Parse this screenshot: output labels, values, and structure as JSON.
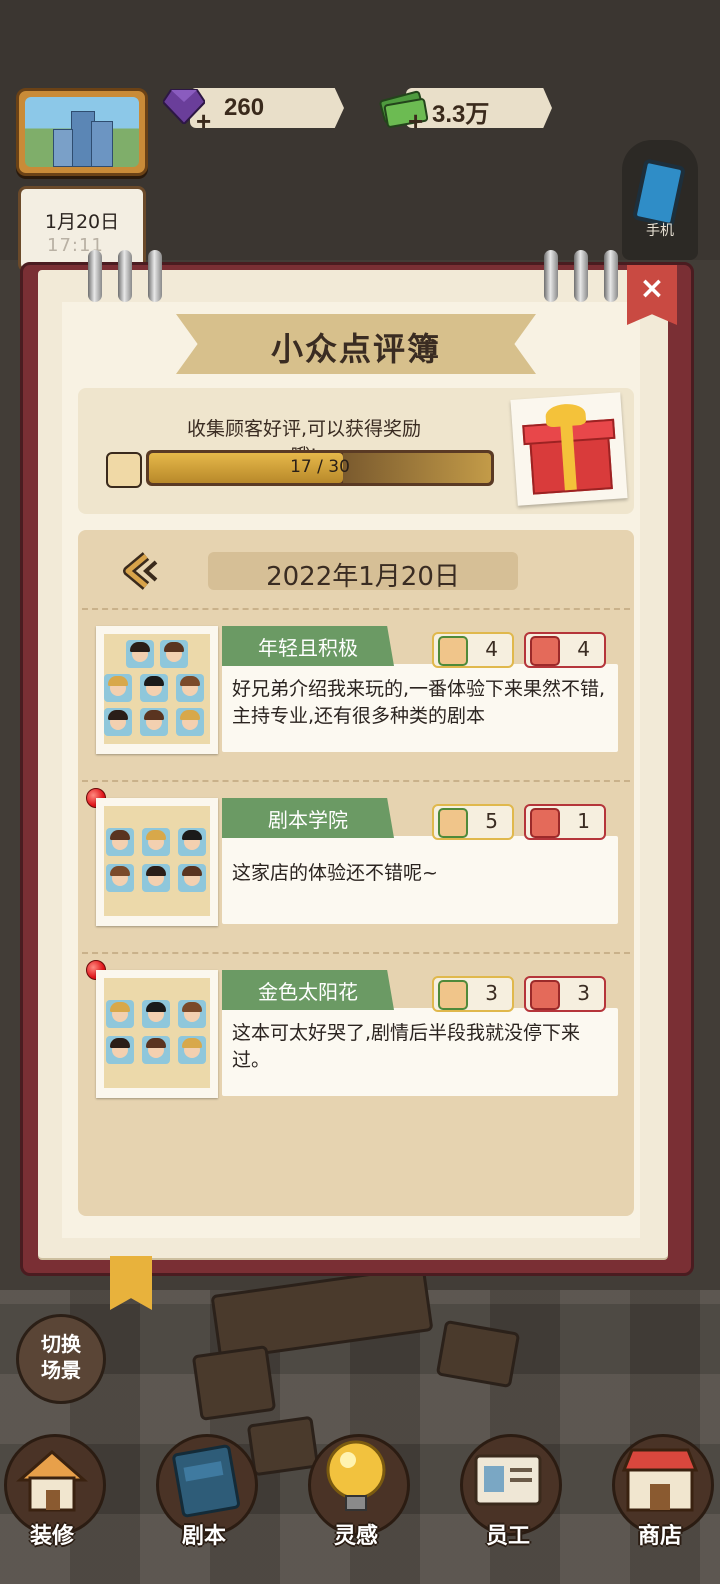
{
  "hud": {
    "gems": "260",
    "cash": "3.3万",
    "calendar_date": "1月20日",
    "calendar_time": "17:11",
    "phone_label": "手机"
  },
  "book": {
    "title": "小众点评簿",
    "close_label": "×",
    "progress_hint": "收集顾客好评,可以获得奖励哦!",
    "progress_text": "17 / 30",
    "progress_fraction": 0.567,
    "date": "2022年1月20日",
    "reviews": [
      {
        "name": "年轻且积极",
        "likes": "4",
        "dislikes": "4",
        "comment": "好兄弟介绍我来玩的,一番体验下来果然不错,主持专业,还有很多种类的剧本"
      },
      {
        "name": "剧本学院",
        "likes": "5",
        "dislikes": "1",
        "comment": "这家店的体验还不错呢~"
      },
      {
        "name": "金色太阳花",
        "likes": "3",
        "dislikes": "3",
        "comment": "这本可太好哭了,剧情后半段我就没停下来过。"
      }
    ]
  },
  "bottom": {
    "switch_scene": "切换场景",
    "nav": [
      {
        "label": "装修",
        "icon": "house-icon"
      },
      {
        "label": "剧本",
        "icon": "script-book-icon"
      },
      {
        "label": "灵感",
        "icon": "lightbulb-icon"
      },
      {
        "label": "员工",
        "icon": "id-card-icon"
      },
      {
        "label": "商店",
        "icon": "shop-icon"
      }
    ]
  },
  "colors": {
    "book_cover": "#7a2f34",
    "paper": "#f2ead7",
    "name_tag": "#6b9a64",
    "like_border": "#e0b84c",
    "dislike_border": "#b5353a",
    "close_button": "#c94a42"
  }
}
